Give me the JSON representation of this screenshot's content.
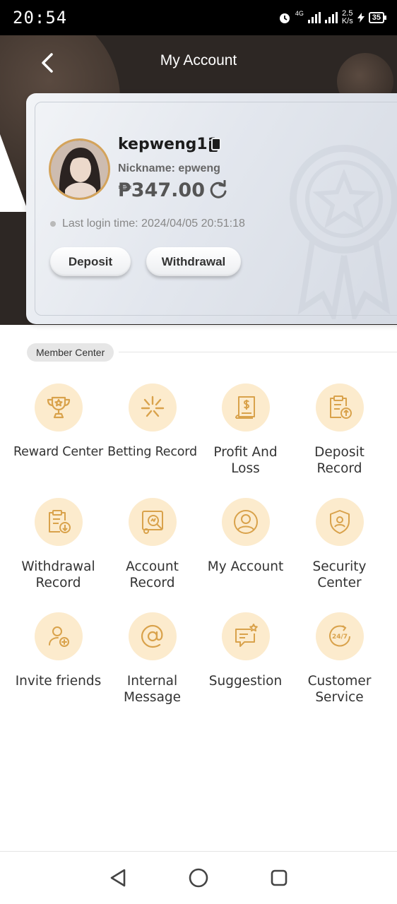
{
  "status_bar": {
    "time": "20:54",
    "network_type": "4G",
    "net_speed_value": "2.5",
    "net_speed_unit": "K/s",
    "battery": "35"
  },
  "header": {
    "title": "My Account"
  },
  "account_card": {
    "username": "kepweng11",
    "nickname": "Nickname: epweng",
    "balance": "₱347.00",
    "last_login": "Last login time: 2024/04/05 20:51:18",
    "deposit_label": "Deposit",
    "withdrawal_label": "Withdrawal"
  },
  "member_center": {
    "tag": "Member Center",
    "items": [
      {
        "label": "Reward Center",
        "icon": "trophy-icon"
      },
      {
        "label": "Betting Record",
        "icon": "sparkle-icon"
      },
      {
        "label": "Profit And Loss",
        "icon": "dollar-receipt-icon"
      },
      {
        "label": "Deposit Record",
        "icon": "clipboard-upload-icon"
      },
      {
        "label": "Withdrawal Record",
        "icon": "clipboard-download-icon"
      },
      {
        "label": "Account Record",
        "icon": "account-record-icon"
      },
      {
        "label": "My Account",
        "icon": "user-circle-icon"
      },
      {
        "label": "Security Center",
        "icon": "shield-user-icon"
      },
      {
        "label": "Invite friends",
        "icon": "user-add-icon"
      },
      {
        "label": "Internal Message",
        "icon": "at-sign-icon"
      },
      {
        "label": "Suggestion",
        "icon": "chat-star-icon"
      },
      {
        "label": "Customer Service",
        "icon": "support-24-7-icon"
      }
    ]
  },
  "colors": {
    "header_bg": "#2d2724",
    "icon_circle": "#fcebcd",
    "icon_stroke": "#d9a24b"
  }
}
